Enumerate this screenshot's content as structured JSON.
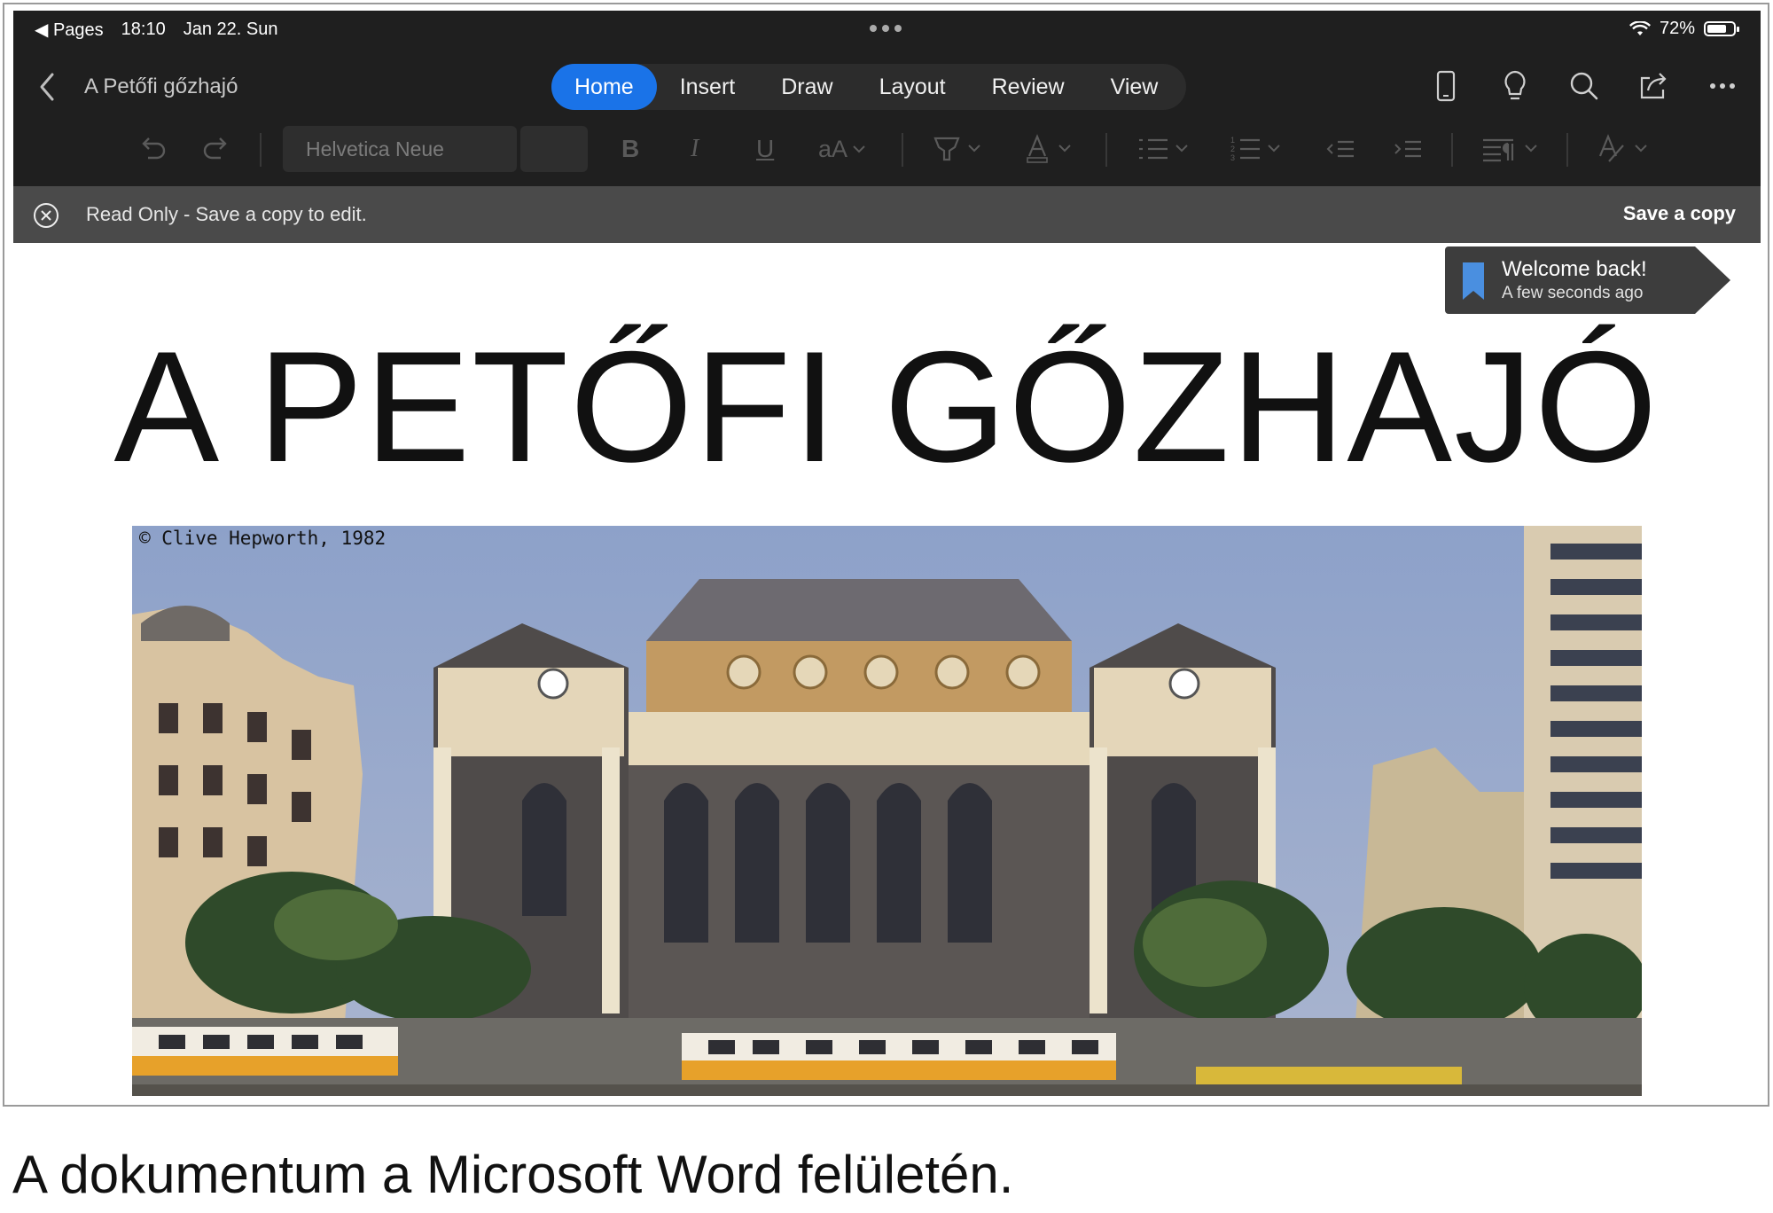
{
  "status_bar": {
    "back_app": "◀ Pages",
    "time": "18:10",
    "date": "Jan 22. Sun",
    "battery": "72%"
  },
  "toolbar": {
    "doc_title": "A Petőfi gőzhajó",
    "tabs": [
      {
        "label": "Home",
        "active": true
      },
      {
        "label": "Insert",
        "active": false
      },
      {
        "label": "Draw",
        "active": false
      },
      {
        "label": "Layout",
        "active": false
      },
      {
        "label": "Review",
        "active": false
      },
      {
        "label": "View",
        "active": false
      }
    ],
    "icons": [
      "phone-view-icon",
      "lightbulb-icon",
      "search-icon",
      "share-icon",
      "more-icon"
    ]
  },
  "ribbon": {
    "font_name": "Helvetica Neue",
    "font_size": "",
    "size_label": "aA"
  },
  "banner": {
    "message": "Read Only - Save a copy to edit.",
    "save_label": "Save a copy"
  },
  "toast": {
    "title": "Welcome back!",
    "subtitle": "A few seconds ago"
  },
  "document": {
    "heading": "A PETŐFI GŐZHAJÓ",
    "photo_credit": "© Clive Hepworth, 1982"
  },
  "caption": "A dokumentum a Microsoft Word felületén.",
  "colors": {
    "accent": "#1a73e8",
    "toolbar_bg": "#1f1f1f",
    "banner_bg": "#4a4a4a"
  }
}
